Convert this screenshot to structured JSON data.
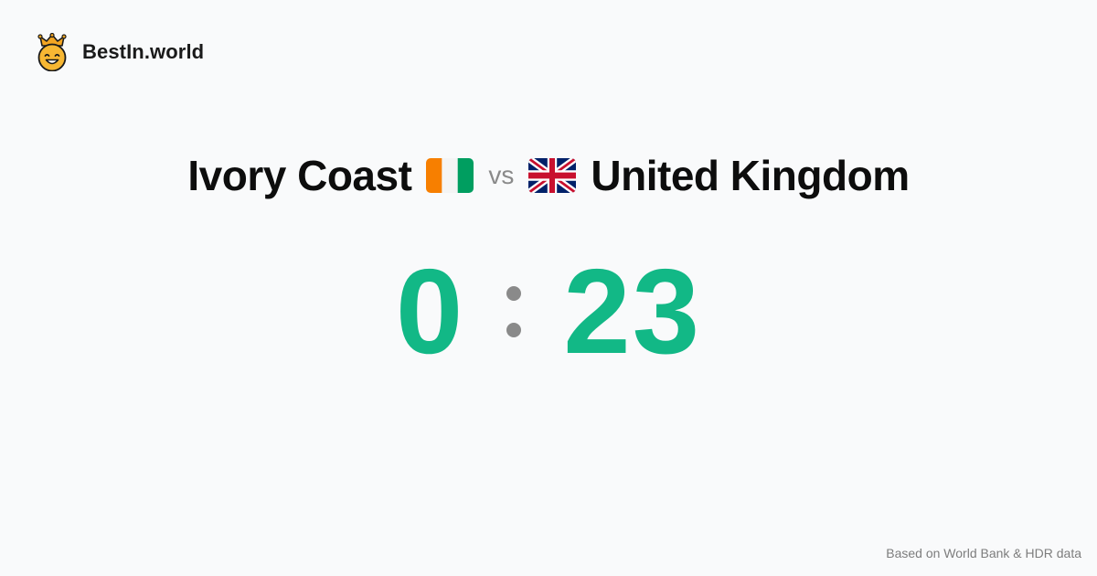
{
  "brand": {
    "name": "BestIn.world",
    "logo_icon": "crowned-smiley-icon"
  },
  "comparison": {
    "left": {
      "name": "Ivory Coast",
      "flag": "ivory-coast-flag-icon"
    },
    "separator": "vs",
    "right": {
      "name": "United Kingdom",
      "flag": "united-kingdom-flag-icon"
    }
  },
  "score": {
    "left": "0",
    "right": "23",
    "color": "#12b886"
  },
  "footer": {
    "source": "Based on World Bank & HDR data"
  }
}
